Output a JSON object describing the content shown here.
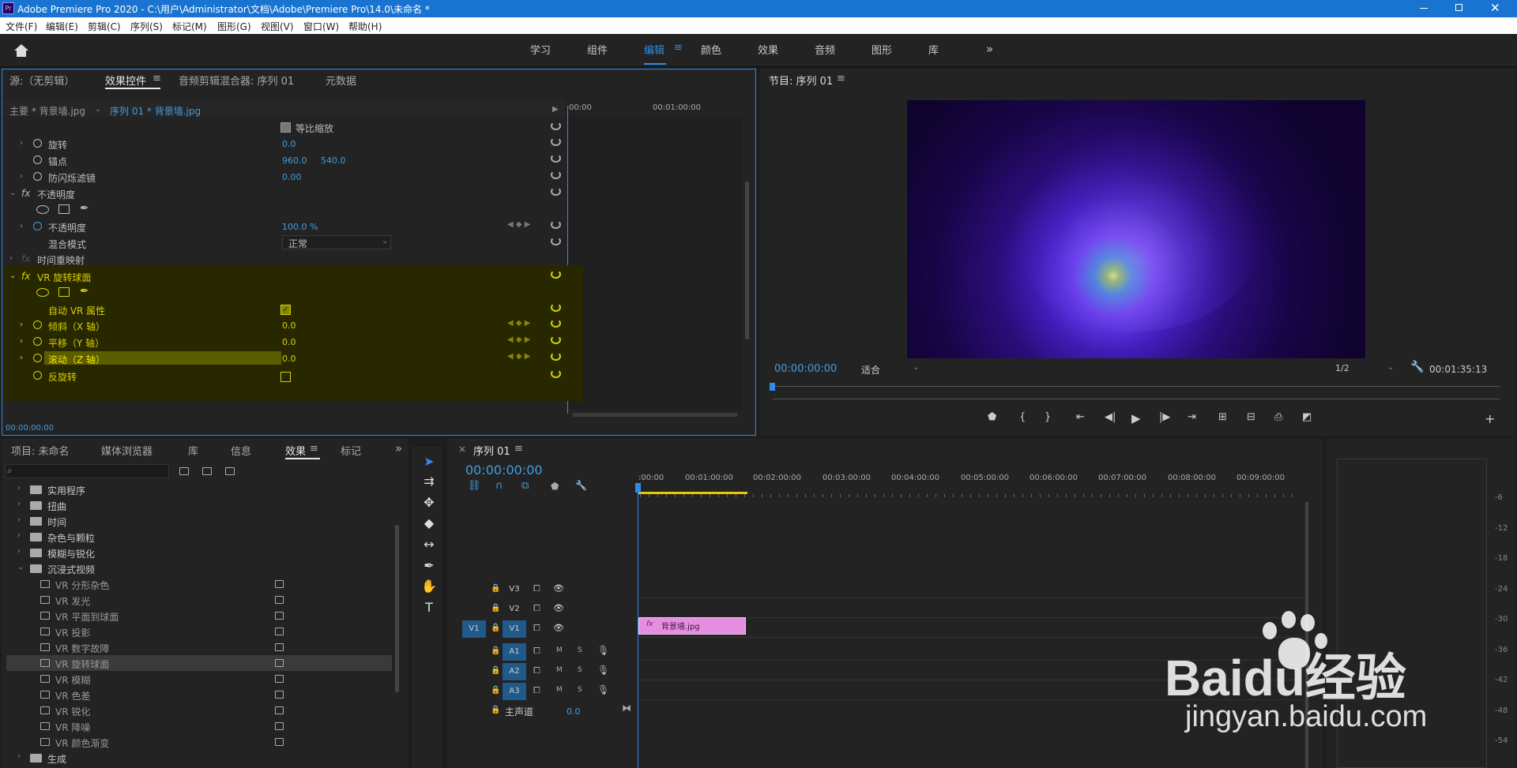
{
  "app": {
    "title": "Adobe Premiere Pro 2020 - C:\\用户\\Administrator\\文档\\Adobe\\Premiere Pro\\14.0\\未命名 *",
    "logo": "Pr",
    "window_controls": [
      "minimize-icon",
      "restore-icon",
      "close-icon"
    ]
  },
  "menu": [
    "文件(F)",
    "编辑(E)",
    "剪辑(C)",
    "序列(S)",
    "标记(M)",
    "图形(G)",
    "视图(V)",
    "窗口(W)",
    "帮助(H)"
  ],
  "workspaces": [
    "学习",
    "组件",
    "编辑",
    "颜色",
    "效果",
    "音频",
    "图形",
    "库"
  ],
  "active_workspace": "编辑",
  "effect_controls": {
    "tabs": [
      "源:（无剪辑）",
      "效果控件",
      "音频剪辑混合器: 序列 01",
      "元数据"
    ],
    "master_clip": "主要 * 背景墙.jpg",
    "sequence_clip": "序列 01 * 背景墙.jpg",
    "ruler": [
      "00:00",
      "00:01:00:00"
    ],
    "uniform_scale": "等比缩放",
    "rotation": {
      "label": "旋转",
      "value": "0.0"
    },
    "anchor": {
      "label": "锚点",
      "x": "960.0",
      "y": "540.0"
    },
    "flicker": {
      "label": "防闪烁滤镜",
      "value": "0.00"
    },
    "opacity_section": "不透明度",
    "opacity": {
      "label": "不透明度",
      "value": "100.0 %"
    },
    "blend": {
      "label": "混合模式",
      "value": "正常"
    },
    "time_remap": "时间重映射",
    "vr_effect": "VR 旋转球面",
    "auto_vr": "自动 VR 属性",
    "tilt": {
      "label": "倾斜（X 轴）",
      "value": "0.0"
    },
    "pan": {
      "label": "平移（Y 轴）",
      "value": "0.0"
    },
    "roll": {
      "label": "滚动（Z 轴）",
      "value": "0.0"
    },
    "reverse": "反旋转",
    "timecode": "00:00:00:00",
    "fx": "fx"
  },
  "program": {
    "title": "节目: 序列 01",
    "timecode": "00:00:00:00",
    "fit": "适合",
    "resolution": "1/2",
    "duration": "00:01:35:13"
  },
  "project": {
    "tabs": [
      "项目: 未命名",
      "媒体浏览器",
      "库",
      "信息",
      "效果",
      "标记"
    ],
    "folders_top": [
      "实用程序",
      "扭曲",
      "时间",
      "杂色与颗粒",
      "模糊与锐化",
      "沉浸式视频"
    ],
    "vr_items": [
      "VR 分形杂色",
      "VR 发光",
      "VR 平面到球面",
      "VR 投影",
      "VR 数字故障",
      "VR 旋转球面",
      "VR 模糊",
      "VR 色差",
      "VR 锐化",
      "VR 降噪",
      "VR 颜色渐变"
    ],
    "folders_bottom": [
      "生成"
    ],
    "selected_item": "VR 旋转球面"
  },
  "timeline": {
    "tab": "序列 01",
    "timecode": "00:00:00:00",
    "ruler": [
      ":00:00",
      "00:01:00:00",
      "00:02:00:00",
      "00:03:00:00",
      "00:04:00:00",
      "00:05:00:00",
      "00:06:00:00",
      "00:07:00:00",
      "00:08:00:00",
      "00:09:00:00"
    ],
    "video_tracks": [
      "V3",
      "V2",
      "V1"
    ],
    "audio_tracks": [
      "A1",
      "A2",
      "A3"
    ],
    "source_v": "V1",
    "m": "M",
    "s": "S",
    "master": {
      "label": "主声道",
      "value": "0.0"
    },
    "clip": "背景墙.jpg"
  },
  "meter": {
    "ticks": [
      "-6",
      "-12",
      "-18",
      "-24",
      "-30",
      "-36",
      "-42",
      "-48",
      "-54"
    ]
  },
  "watermark": {
    "brand": "Baidu经验",
    "url": "jingyan.baidu.com"
  },
  "colors": {
    "accent": "#2d8ceb",
    "title_bar": "#1874d0",
    "clip": "#e58ee0",
    "highlight": "#3b3a00",
    "timecode": "#3e9ee0"
  }
}
